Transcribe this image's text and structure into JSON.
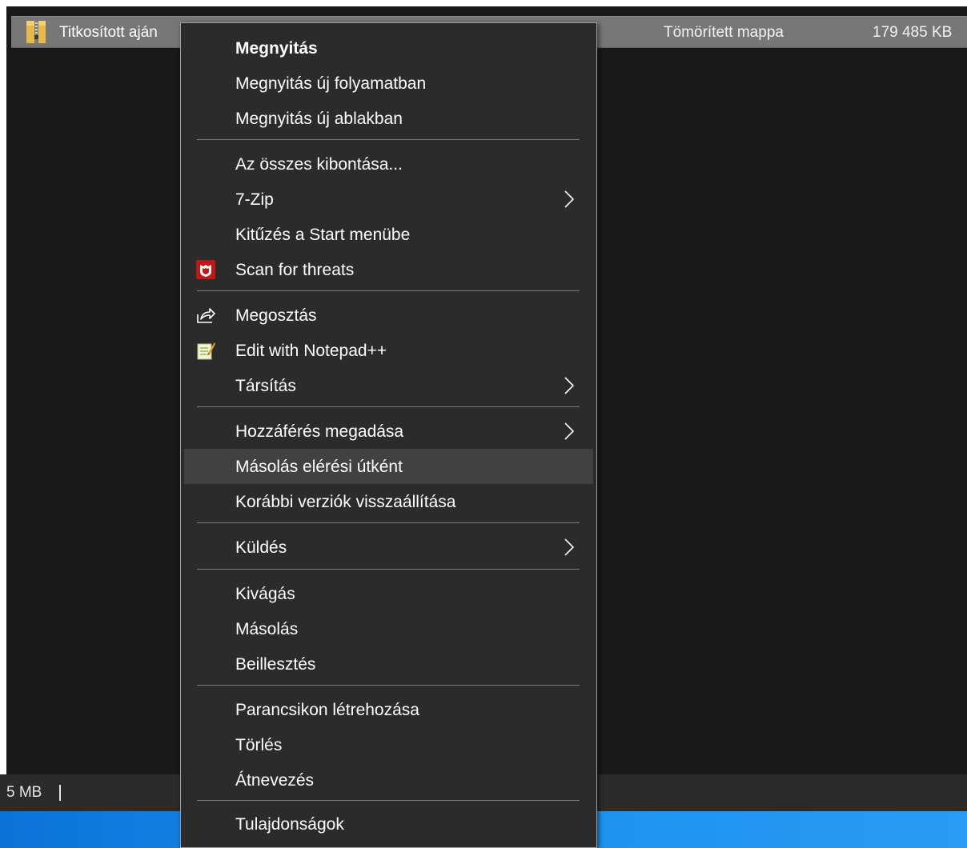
{
  "file": {
    "name": "Titkosított aján",
    "type": "Tömörített mappa",
    "size": "179 485 KB",
    "icon": "zip-folder-icon"
  },
  "statusbar": {
    "selection_size": "5 MB"
  },
  "menu": {
    "open": "Megnyitás",
    "open_new_process": "Megnyitás új folyamatban",
    "open_new_window": "Megnyitás új ablakban",
    "extract_all": "Az összes kibontása...",
    "seven_zip": "7-Zip",
    "pin_start": "Kitűzés a Start menübe",
    "scan_threats": "Scan for threats",
    "share": "Megosztás",
    "edit_notepadpp": "Edit with Notepad++",
    "open_with": "Társítás",
    "give_access": "Hozzáférés megadása",
    "copy_as_path": "Másolás elérési útként",
    "restore_versions": "Korábbi verziók visszaállítása",
    "send_to": "Küldés",
    "cut": "Kivágás",
    "copy": "Másolás",
    "paste": "Beillesztés",
    "create_shortcut": "Parancsikon létrehozása",
    "delete": "Törlés",
    "rename": "Átnevezés",
    "properties": "Tulajdonságok",
    "highlighted_item": "Másolás elérési útként"
  },
  "colors": {
    "menu_bg": "#2b2b2b",
    "highlight_bg": "#414141",
    "selected_row": "#777777",
    "mcafee_red": "#c01818",
    "taskbar_blue": "#1a8ff0"
  }
}
